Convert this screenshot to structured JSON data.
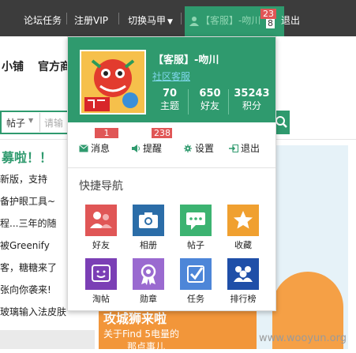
{
  "topbar": {
    "links": [
      "论坛任务",
      "注册VIP",
      "切换马甲"
    ],
    "username": "【客服】-吻川",
    "logout": "退出",
    "badge_top": "23",
    "badge_bottom": "8"
  },
  "background": {
    "nav_left": "小铺",
    "nav_right": "官方商",
    "search_type": "帖子",
    "search_placeholder": "请输",
    "headline": "募啦！！",
    "lines": [
      "新版，支持",
      "备护眼工具~",
      "程...三年的随",
      "被Greenify",
      "客，糖糖来了",
      "张向你袭来!",
      "玻璃输入法皮肤"
    ],
    "banner_title": "攻城狮来啦",
    "banner_sub": "关于Find 5电量的",
    "banner_sub2": "那点事儿",
    "watermark": "www.wooyun.org"
  },
  "panel": {
    "name": "【客服】-吻川",
    "group": "社区客服",
    "stats": [
      {
        "value": "70",
        "label": "主题"
      },
      {
        "value": "650",
        "label": "好友"
      },
      {
        "value": "35243",
        "label": "积分"
      }
    ],
    "actions": [
      {
        "label": "消息",
        "badge": "1"
      },
      {
        "label": "提醒",
        "badge": "238"
      },
      {
        "label": "设置",
        "badge": ""
      },
      {
        "label": "退出",
        "badge": ""
      }
    ],
    "quick_title": "快捷导航",
    "tiles": [
      {
        "label": "好友",
        "color": "#e05656"
      },
      {
        "label": "相册",
        "color": "#2b6da8"
      },
      {
        "label": "帖子",
        "color": "#3cb371"
      },
      {
        "label": "收藏",
        "color": "#f0a030"
      },
      {
        "label": "淘帖",
        "color": "#7b3fb5"
      },
      {
        "label": "勋章",
        "color": "#9a6ad0"
      },
      {
        "label": "任务",
        "color": "#4d86d8"
      },
      {
        "label": "排行榜",
        "color": "#1f4fa8"
      }
    ]
  },
  "colors": {
    "accent": "#2f9a6e",
    "badge": "#e05656",
    "topbar": "#3c3c3c"
  }
}
